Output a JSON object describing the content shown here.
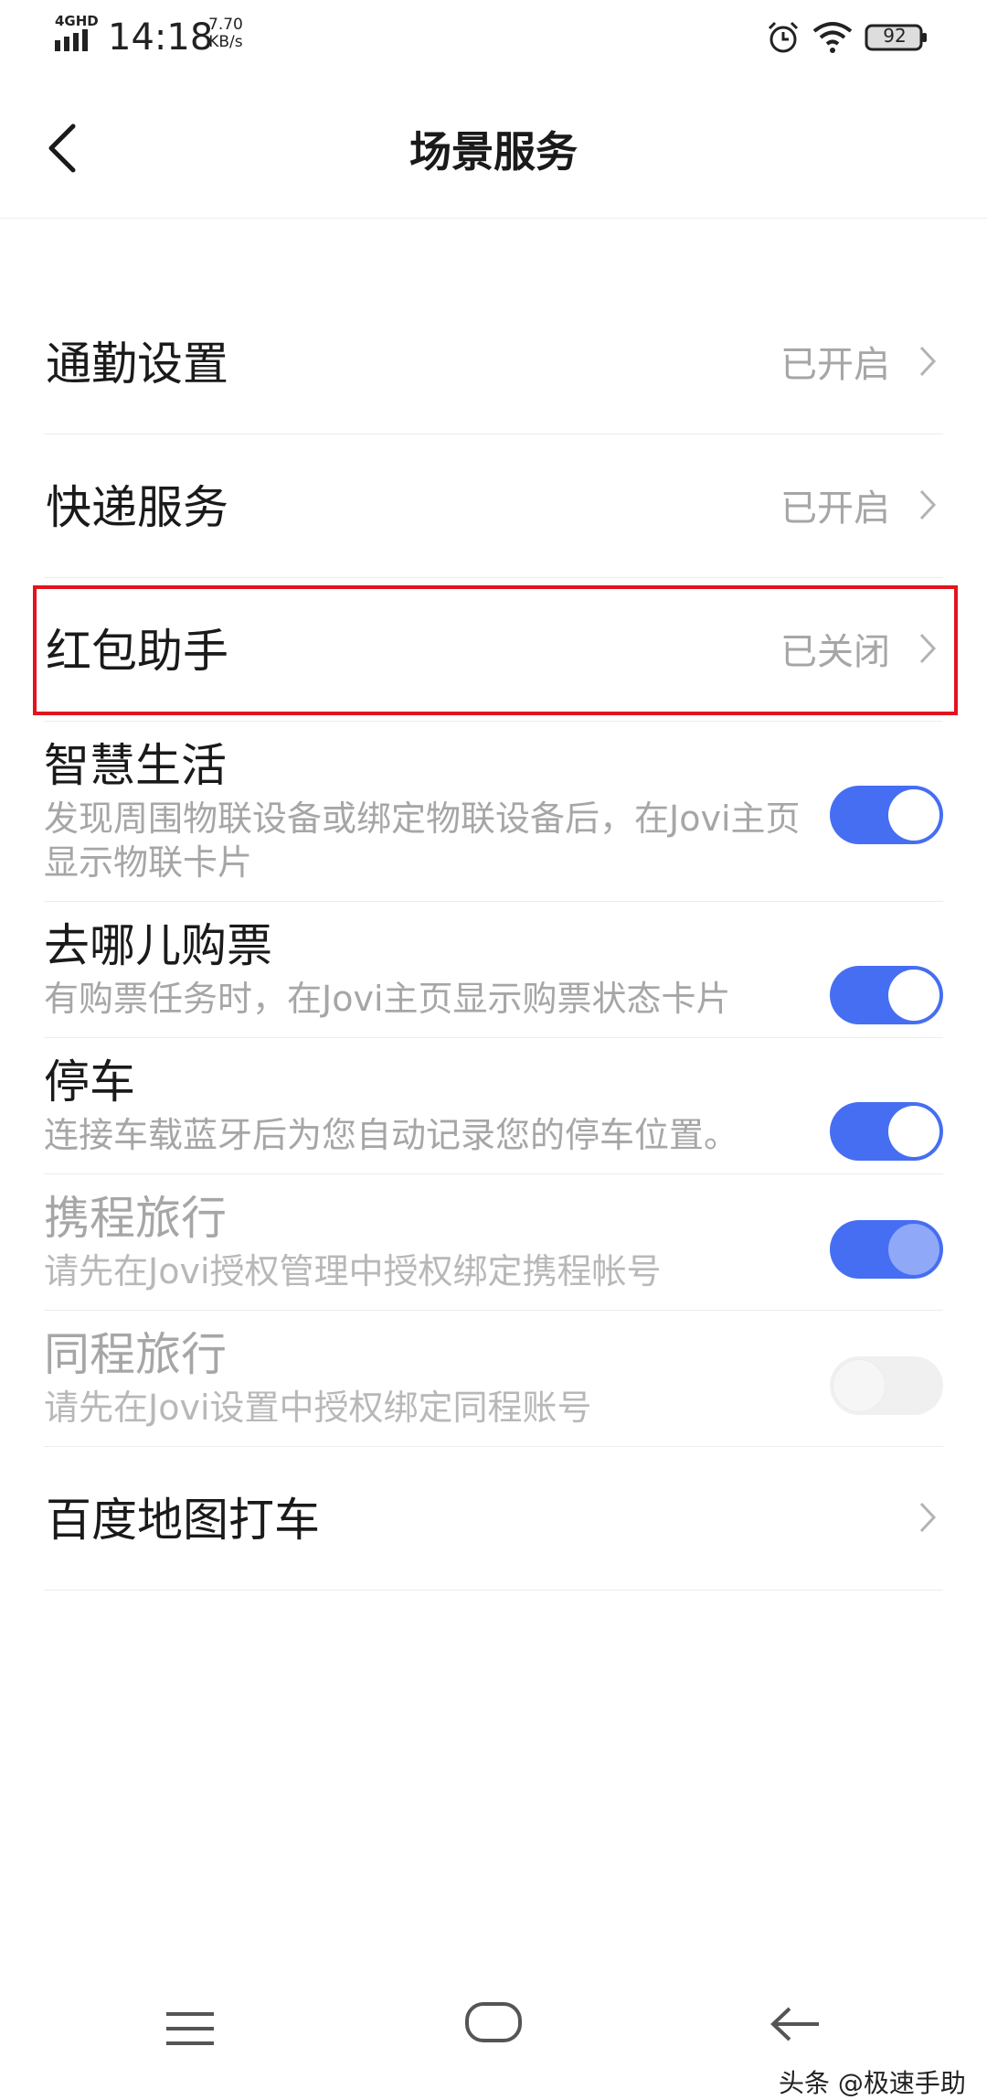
{
  "status_bar": {
    "network": "4GHD",
    "time": "14:18",
    "speed_value": "7.70",
    "speed_unit": "KB/s",
    "battery": "92"
  },
  "header": {
    "title": "场景服务",
    "back_icon": "chevron-left-icon"
  },
  "items": [
    {
      "title": "通勤设置",
      "status": "已开启",
      "type": "nav"
    },
    {
      "title": "快递服务",
      "status": "已开启",
      "type": "nav"
    },
    {
      "title": "红包助手",
      "status": "已关闭",
      "type": "nav",
      "highlighted": true
    },
    {
      "title": "智慧生活",
      "desc": "发现周围物联设备或绑定物联设备后，在Jovi主页显示物联卡片",
      "type": "toggle",
      "state": "on"
    },
    {
      "title": "去哪儿购票",
      "desc": "有购票任务时，在Jovi主页显示购票状态卡片",
      "type": "toggle",
      "state": "on"
    },
    {
      "title": "停车",
      "desc": "连接车载蓝牙后为您自动记录您的停车位置。",
      "type": "toggle",
      "state": "on"
    },
    {
      "title": "携程旅行",
      "desc": "请先在Jovi授权管理中授权绑定携程帐号",
      "type": "toggle",
      "state": "on-disabled"
    },
    {
      "title": "同程旅行",
      "desc": "请先在Jovi设置中授权绑定同程账号",
      "type": "toggle",
      "state": "off-disabled"
    },
    {
      "title": "百度地图打车",
      "status": "",
      "type": "nav"
    }
  ],
  "colors": {
    "accent": "#456ef3",
    "highlight": "#e2141e",
    "secondary_text": "#a6a6a6"
  },
  "nav_bar": {
    "menu_icon": "menu-icon",
    "home_icon": "home-icon",
    "back_icon": "back-arrow-icon"
  },
  "watermark": "头条 @极速手助"
}
